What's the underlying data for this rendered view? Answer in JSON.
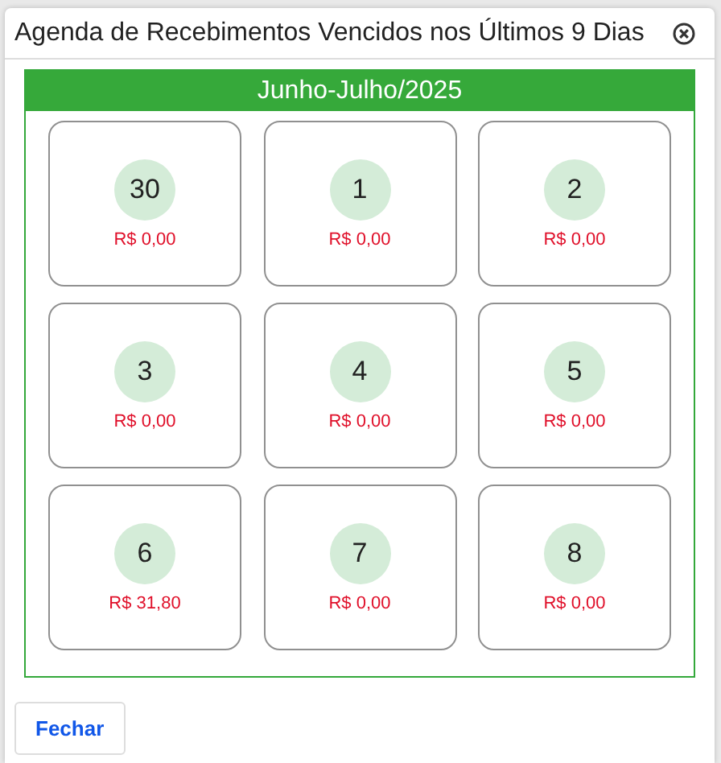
{
  "dialog": {
    "title": "Agenda de Recebimentos Vencidos nos Últimos 9 Dias"
  },
  "calendar": {
    "period": "Junho-Julho/2025",
    "days": [
      {
        "day": "30",
        "amount": "R$ 0,00"
      },
      {
        "day": "1",
        "amount": "R$ 0,00"
      },
      {
        "day": "2",
        "amount": "R$ 0,00"
      },
      {
        "day": "3",
        "amount": "R$ 0,00"
      },
      {
        "day": "4",
        "amount": "R$ 0,00"
      },
      {
        "day": "5",
        "amount": "R$ 0,00"
      },
      {
        "day": "6",
        "amount": "R$ 31,80"
      },
      {
        "day": "7",
        "amount": "R$ 0,00"
      },
      {
        "day": "8",
        "amount": "R$ 0,00"
      }
    ]
  },
  "buttons": [
    {
      "label": "Fechar"
    }
  ]
}
